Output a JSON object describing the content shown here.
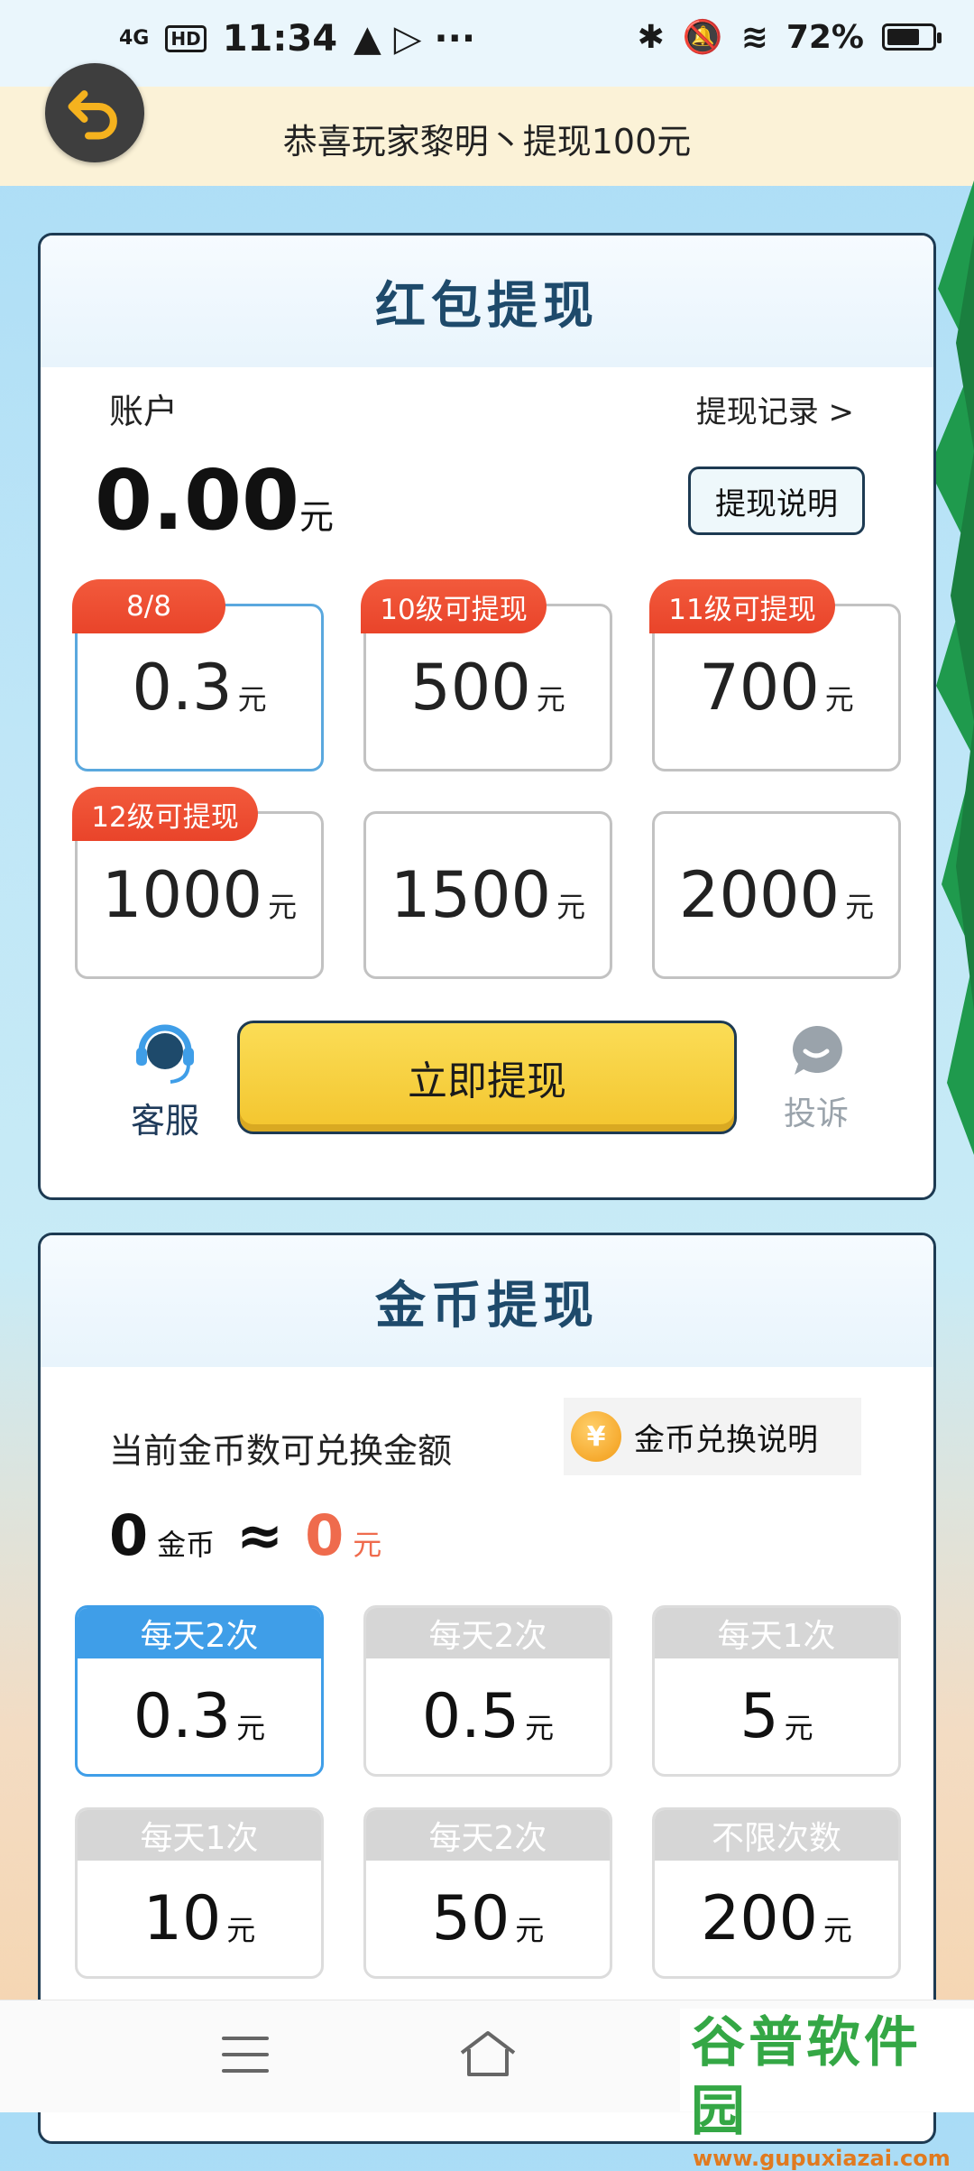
{
  "status": {
    "network": "4G",
    "hd": "HD",
    "time": "11:34",
    "battery": "72%",
    "battery_level": 0.72
  },
  "banner": {
    "text": "恭喜玩家黎明丶提现100元"
  },
  "red": {
    "title": "红包提现",
    "account_label": "账户",
    "records_link": "提现记录 >",
    "balance": "0.00",
    "balance_unit": "元",
    "explain_button": "提现说明",
    "options": [
      {
        "tag": "8/8",
        "value": "0.3",
        "unit": "元",
        "selected": true
      },
      {
        "tag": "10级可提现",
        "value": "500",
        "unit": "元",
        "selected": false
      },
      {
        "tag": "11级可提现",
        "value": "700",
        "unit": "元",
        "selected": false
      },
      {
        "tag": "12级可提现",
        "value": "1000",
        "unit": "元",
        "selected": false
      },
      {
        "tag": "",
        "value": "1500",
        "unit": "元",
        "selected": false
      },
      {
        "tag": "",
        "value": "2000",
        "unit": "元",
        "selected": false
      }
    ],
    "service_label": "客服",
    "withdraw_button": "立即提现",
    "complain_label": "投诉"
  },
  "coin": {
    "title": "金币提现",
    "exchange_label": "当前金币数可兑换金额",
    "explain_button": "金币兑换说明",
    "coin_icon_symbol": "¥",
    "coins": "0",
    "coins_unit": "金币",
    "approx": "≈",
    "yuan": "0",
    "yuan_unit": "元",
    "options": [
      {
        "limit": "每天2次",
        "value": "0.3",
        "unit": "元",
        "selected": true
      },
      {
        "limit": "每天2次",
        "value": "0.5",
        "unit": "元",
        "selected": false
      },
      {
        "limit": "每天1次",
        "value": "5",
        "unit": "元",
        "selected": false
      },
      {
        "limit": "每天1次",
        "value": "10",
        "unit": "元",
        "selected": false
      },
      {
        "limit": "每天2次",
        "value": "50",
        "unit": "元",
        "selected": false
      },
      {
        "limit": "不限次数",
        "value": "200",
        "unit": "元",
        "selected": false
      }
    ]
  },
  "watermark": {
    "title": "谷普软件园",
    "url": "www.gupuxiazai.com"
  },
  "icons": [
    "back-arrow-icon",
    "headset-icon",
    "chat-bubble-icon",
    "menu-icon",
    "home-icon",
    "coin-icon",
    "bluetooth-icon",
    "mute-icon",
    "wifi-icon"
  ],
  "colors": {
    "accent_blue": "#3f9ee8",
    "tag_red": "#e9442a",
    "button_yellow": "#f3c52e",
    "title_blue": "#1e4a6b",
    "coin_orange": "#ef6b4d"
  }
}
